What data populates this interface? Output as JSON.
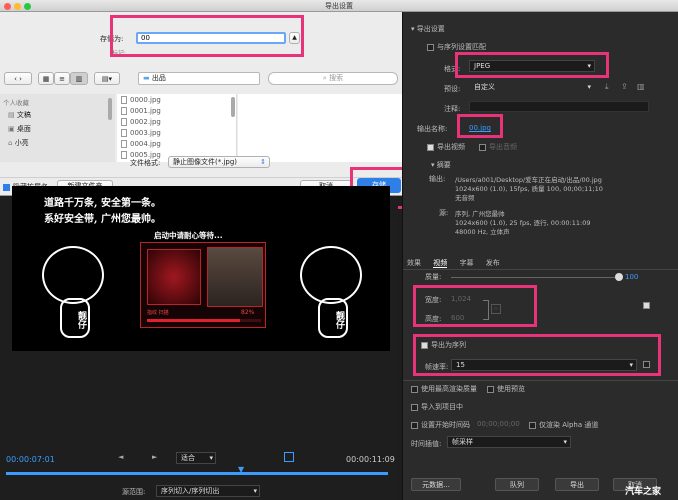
{
  "window": {
    "title": "导出设置"
  },
  "save_dialog": {
    "save_as_label": "存储为:",
    "filename_value": "00",
    "tags_label": "标记:",
    "folder_name": "出品",
    "search_placeholder": "搜索",
    "sidebar": {
      "header": "个人收藏",
      "items": [
        "文稿",
        "桌面",
        "小亮"
      ]
    },
    "files": [
      "0000.jpg",
      "0001.jpg",
      "0002.jpg",
      "0003.jpg",
      "0004.jpg",
      "0005.jpg"
    ],
    "format_label": "文件格式:",
    "format_value": "静止图像文件(*.jpg)",
    "hide_ext_label": "隐藏扩展名",
    "new_folder_label": "新建文件夹",
    "cancel_label": "取消",
    "save_label": "存储"
  },
  "monitor": {
    "video_text": {
      "line1": "道路千万条, 安全第一条。",
      "line2": "系好安全带, 广州您最帅。",
      "loading": "启动中请耐心等待...",
      "mascot_left": "靓仔",
      "mascot_right": "靓仔",
      "progress_pct": "82%",
      "scan_label": "指纹 扫描"
    },
    "timecode_current": "00:00:07:01",
    "fit_label": "适合",
    "timecode_end": "00:00:11:09",
    "source_range_label": "源范围:",
    "source_range_value": "序列切入/序列切出"
  },
  "export": {
    "section_title": "导出设置",
    "match_sequence_label": "与序列设置匹配",
    "format_label": "格式:",
    "format_value": "JPEG",
    "preset_label": "预设:",
    "preset_value": "自定义",
    "comment_label": "注释:",
    "output_name_label": "输出名称:",
    "output_name_value": "00.jpg",
    "export_video_label": "导出视频",
    "export_audio_label": "导出音频",
    "summary_title": "摘要",
    "output_label": "输出:",
    "output_lines": [
      "/Users/a001/Desktop/爱车正在启动/出品/00.jpg",
      "1024x600 (1.0), 15fps, 质量 100, 00;00;11;10",
      "无音频"
    ],
    "source_label": "源:",
    "source_lines": [
      "序列, 广州您最帅",
      "1024x600 (1.0), 25 fps, 逐行, 00:00:11:09",
      "48000 Hz, 立体声"
    ],
    "tabs": [
      "效果",
      "视频",
      "字幕",
      "发布"
    ],
    "quality_label": "质量:",
    "quality_value": "100",
    "width_label": "宽度:",
    "width_value": "1,024",
    "height_label": "高度:",
    "height_value": "600",
    "export_as_sequence_label": "导出为序列",
    "frame_rate_label": "帧速率:",
    "frame_rate_value": "15",
    "max_render_label": "使用最高渲染质量",
    "use_preview_label": "使用预览",
    "import_project_label": "导入到项目中",
    "set_start_tc_label": "设置开始时间码",
    "start_tc_value": "00;00;00;00",
    "render_alpha_label": "仅渲染 Alpha 通道",
    "time_interp_label": "时间插值:",
    "time_interp_value": "帧采样",
    "metadata_label": "元数据...",
    "queue_label": "队列",
    "export_label": "导出",
    "cancel_label": "取消"
  },
  "watermark": "汽车之家",
  "colors": {
    "highlight": "#e8327a",
    "accent_blue": "#3b9cff",
    "mac_blue": "#2f7fe8"
  }
}
